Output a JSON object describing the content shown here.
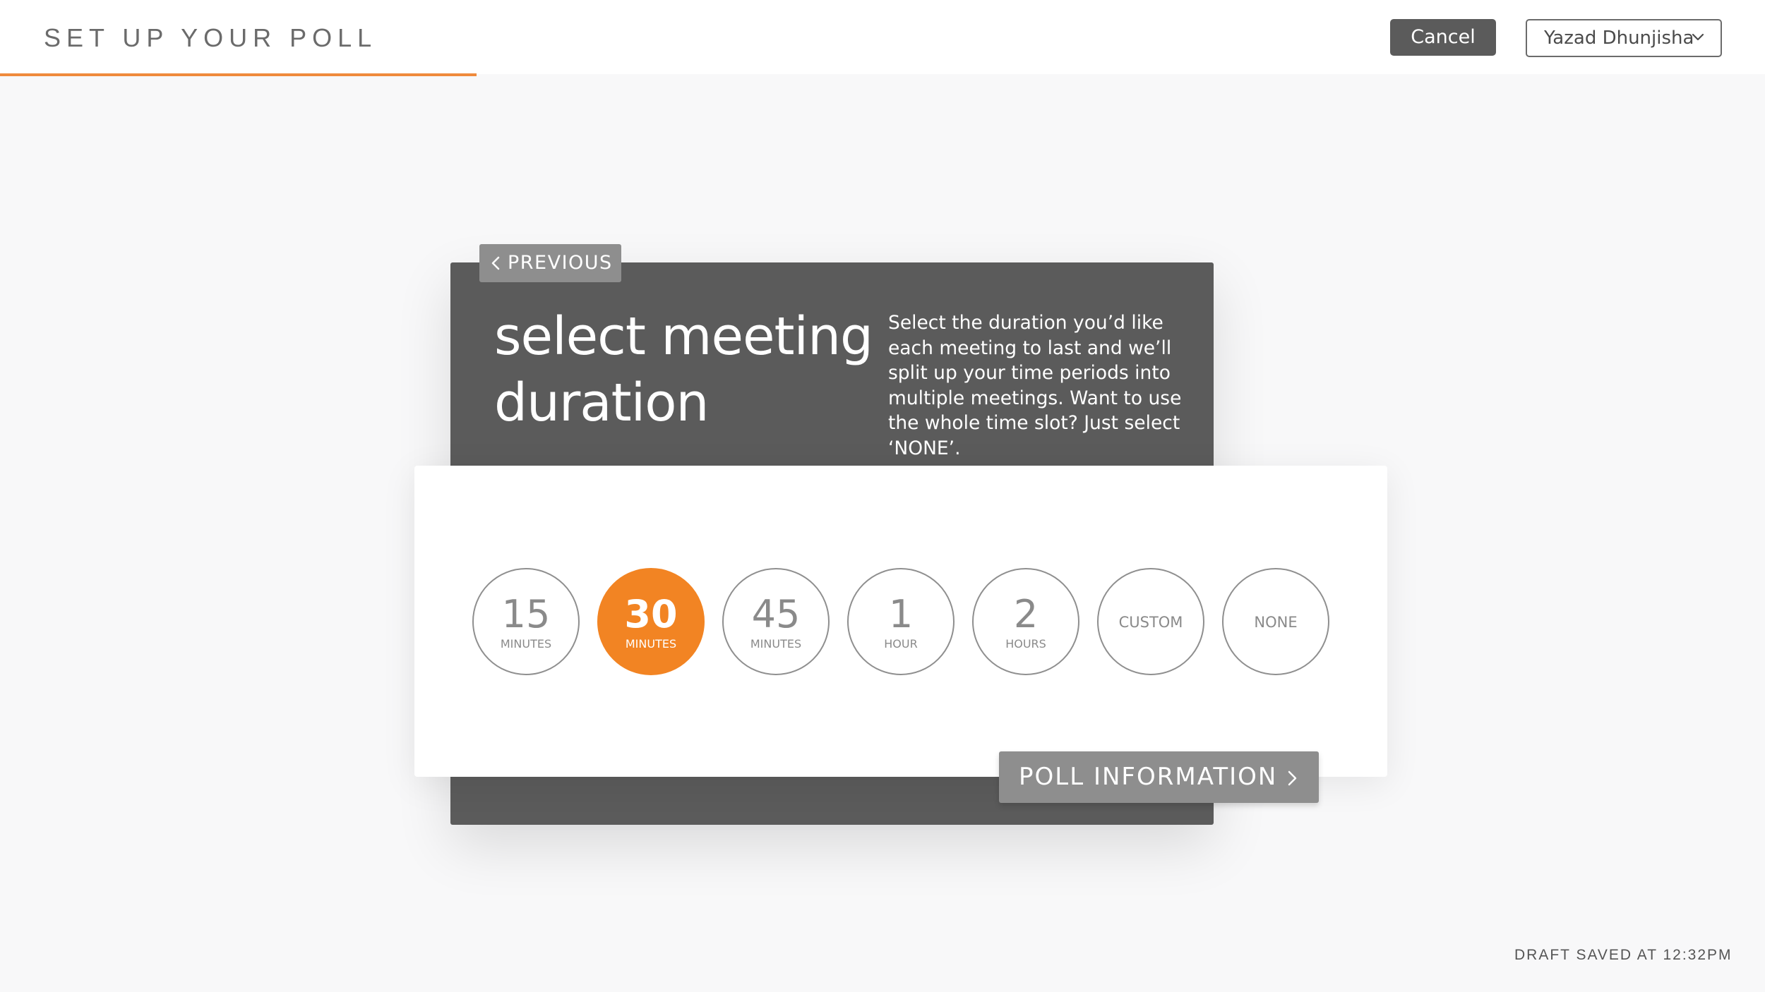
{
  "header": {
    "title": "SET UP YOUR POLL",
    "progress_fraction": 0.27,
    "accent_color": "#ef8a3c",
    "cancel_label": "Cancel",
    "user_name": "Yazad Dhunjisha",
    "user_menu_icon": "chevron-down-icon"
  },
  "step": {
    "previous_label": "PREVIOUS",
    "previous_icon": "chevron-left-icon",
    "heading_line1": "select meeting",
    "heading_line2": "duration",
    "description": "Select the duration you’d like each meeting to last and we’ll split up your time periods into multiple meetings. Want to use the whole time slot? Just select ‘NONE’.",
    "options": [
      {
        "number": "15",
        "unit": "MINUTES",
        "selected": false
      },
      {
        "number": "30",
        "unit": "MINUTES",
        "selected": true
      },
      {
        "number": "45",
        "unit": "MINUTES",
        "selected": false
      },
      {
        "number": "1",
        "unit": "HOUR",
        "selected": false
      },
      {
        "number": "2",
        "unit": "HOURS",
        "selected": false
      },
      {
        "word": "CUSTOM",
        "selected": false
      },
      {
        "word": "NONE",
        "selected": false
      }
    ],
    "selected_color": "#f28423",
    "next_label": "POLL INFORMATION",
    "next_icon": "chevron-right-icon"
  },
  "footer": {
    "draft_status": "DRAFT SAVED AT 12:32PM"
  }
}
